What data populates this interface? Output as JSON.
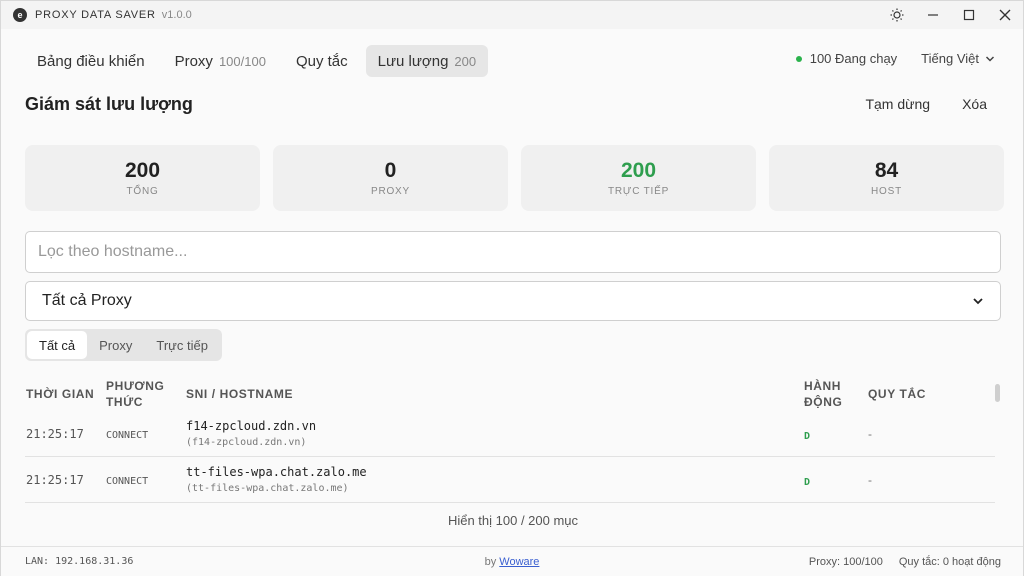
{
  "titlebar": {
    "logo": "e",
    "title": "PROXY DATA SAVER",
    "version": "v1.0.0"
  },
  "icons": {
    "theme": "sun-icon",
    "minimize": "minimize-icon",
    "maximize": "maximize-icon",
    "close": "close-icon",
    "chevron": "chevron-down-icon"
  },
  "nav": {
    "tabs": [
      {
        "label": "Bảng điều khiển",
        "count": ""
      },
      {
        "label": "Proxy",
        "count": "100/100"
      },
      {
        "label": "Quy tắc",
        "count": ""
      },
      {
        "label": "Lưu lượng",
        "count": "200"
      }
    ],
    "running": "100 Đang chạy",
    "language": "Tiếng Việt"
  },
  "page": {
    "title": "Giám sát lưu lượng",
    "pause": "Tạm dừng",
    "clear": "Xóa"
  },
  "stats": [
    {
      "value": "200",
      "label": "TỔNG"
    },
    {
      "value": "0",
      "label": "PROXY"
    },
    {
      "value": "200",
      "label": "TRỰC TIẾP"
    },
    {
      "value": "84",
      "label": "HOST"
    }
  ],
  "filter": {
    "placeholder": "Lọc theo hostname...",
    "select": "Tất cả Proxy"
  },
  "segments": [
    "Tất cả",
    "Proxy",
    "Trực tiếp"
  ],
  "table": {
    "headers": {
      "time": "THỜI GIAN",
      "method_1": "PHƯƠNG",
      "method_2": "THỨC",
      "host": "SNI / HOSTNAME",
      "action_1": "HÀNH",
      "action_2": "ĐỘNG",
      "rule": "QUY TẮC"
    },
    "rows": [
      {
        "time": "21:25:17",
        "method": "CONNECT",
        "host": "f14-zpcloud.zdn.vn",
        "sub": "(f14-zpcloud.zdn.vn)",
        "action": "D",
        "rule": "-"
      },
      {
        "time": "21:25:17",
        "method": "CONNECT",
        "host": "tt-files-wpa.chat.zalo.me",
        "sub": "(tt-files-wpa.chat.zalo.me)",
        "action": "D",
        "rule": "-"
      }
    ],
    "showing": "Hiển thị 100 / 200 mục"
  },
  "footer": {
    "lan": "LAN: 192.168.31.36",
    "by": "by",
    "author": "Woware",
    "proxy": "Proxy: 100/100",
    "rules": "Quy tắc: 0 hoạt động"
  },
  "colors": {
    "running_dot": "#2bb24c",
    "direct_green": "#2e9e4e"
  }
}
